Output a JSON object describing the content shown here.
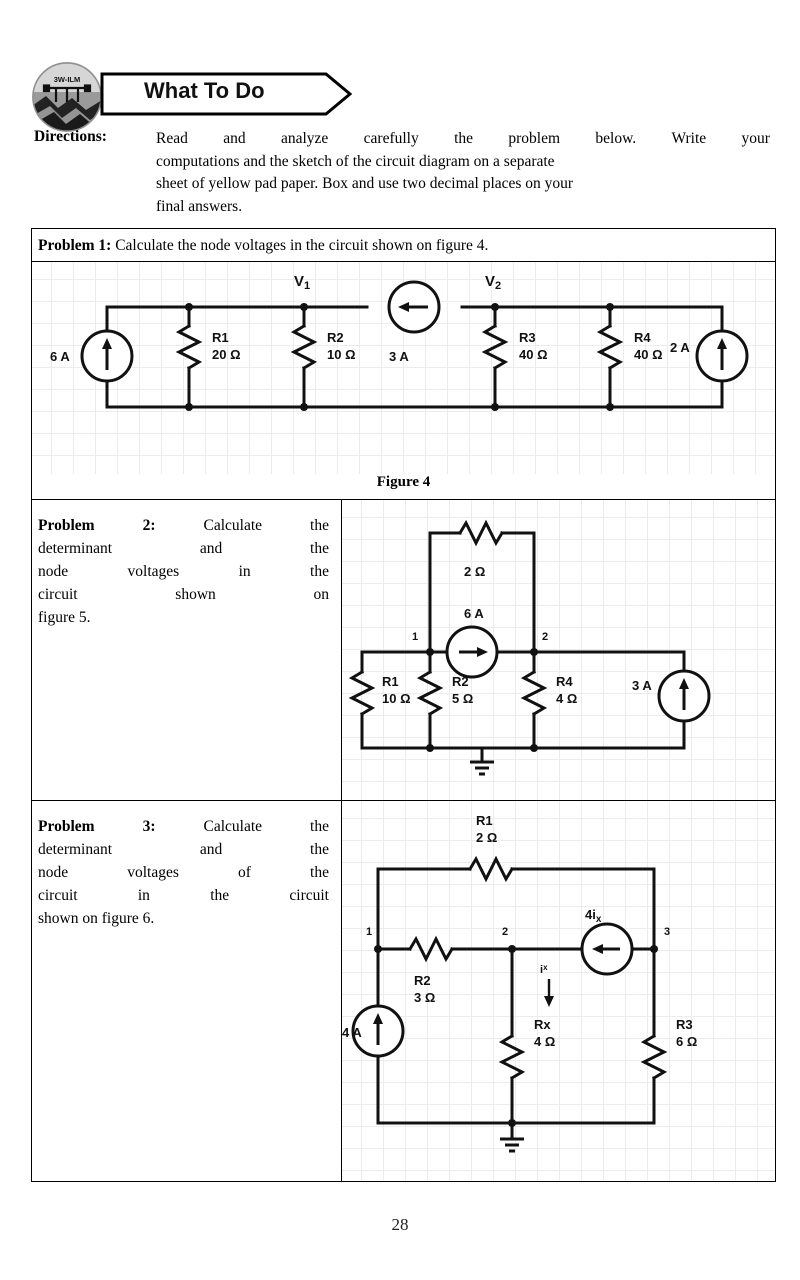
{
  "header": {
    "title": "What To Do",
    "logo_text": "3W-ILM",
    "logo_name": "module-logo"
  },
  "directions": {
    "label": "Directions:",
    "lines": [
      "Read and analyze carefully the problem below. Write your",
      "computations  and the sketch of the circuit diagram on a separate",
      "sheet of yellow pad paper. Box and use two decimal places  on your",
      "final answers."
    ]
  },
  "problems": [
    {
      "label": "Problem 1:",
      "text": "Calculate the node voltages in the circuit shown on figure 4.",
      "caption": "Figure 4"
    },
    {
      "label_word": "Problem",
      "number": "2:",
      "lines": [
        "Calculate the",
        "determinant and the",
        "node voltages in the",
        "circuit shown on",
        "figure 5."
      ]
    },
    {
      "label_word": "Problem",
      "number": "3:",
      "lines": [
        "Calculate the",
        "determinant and the",
        "node voltages of the",
        "circuit in the circuit",
        "shown on  figure 6."
      ]
    }
  ],
  "figure4": {
    "nodes": [
      "V₁",
      "V₂"
    ],
    "sources": [
      {
        "name": "left-current-source",
        "label": "6 A",
        "direction": "up"
      },
      {
        "name": "middle-current-source",
        "label": "3 A",
        "direction": "left"
      },
      {
        "name": "right-current-source",
        "label": "2 A",
        "direction": "up"
      }
    ],
    "resistors": [
      {
        "name": "R1",
        "value": "20 Ω"
      },
      {
        "name": "R2",
        "value": "10 Ω"
      },
      {
        "name": "R3",
        "value": "40 Ω"
      },
      {
        "name": "R4",
        "value": "40 Ω"
      }
    ]
  },
  "figure5": {
    "nodes": [
      "1",
      "2"
    ],
    "top_resistor": "2 Ω",
    "top_source": "6 A",
    "sources": [
      {
        "name": "middle-current-source",
        "label": "6 A",
        "direction": "right"
      },
      {
        "name": "right-current-source",
        "label": "3 A",
        "direction": "up"
      }
    ],
    "resistors": [
      {
        "name": "R1",
        "value": "10 Ω"
      },
      {
        "name": "R2",
        "value": "5 Ω"
      },
      {
        "name": "R4",
        "value": "4 Ω"
      }
    ]
  },
  "figure6": {
    "nodes": [
      "1",
      "2",
      "3"
    ],
    "dependent_source": "4i",
    "dependent_source_sub": "x",
    "current_label": "i",
    "current_label_sub": "x",
    "sources": [
      {
        "name": "left-current-source",
        "label": "4 A",
        "direction": "up"
      },
      {
        "name": "dependent-current-source",
        "label": "4iₓ",
        "direction": "left"
      }
    ],
    "resistors": [
      {
        "name": "R1",
        "value": "2 Ω"
      },
      {
        "name": "R2",
        "value": "3 Ω"
      },
      {
        "name": "Rx",
        "value": "4 Ω"
      },
      {
        "name": "R3",
        "value": "6 Ω"
      }
    ]
  },
  "footer": {
    "page_number": "28"
  },
  "colors": {
    "ink": "#000000",
    "grid": "#ececec",
    "caret": "#6a7fb0"
  }
}
